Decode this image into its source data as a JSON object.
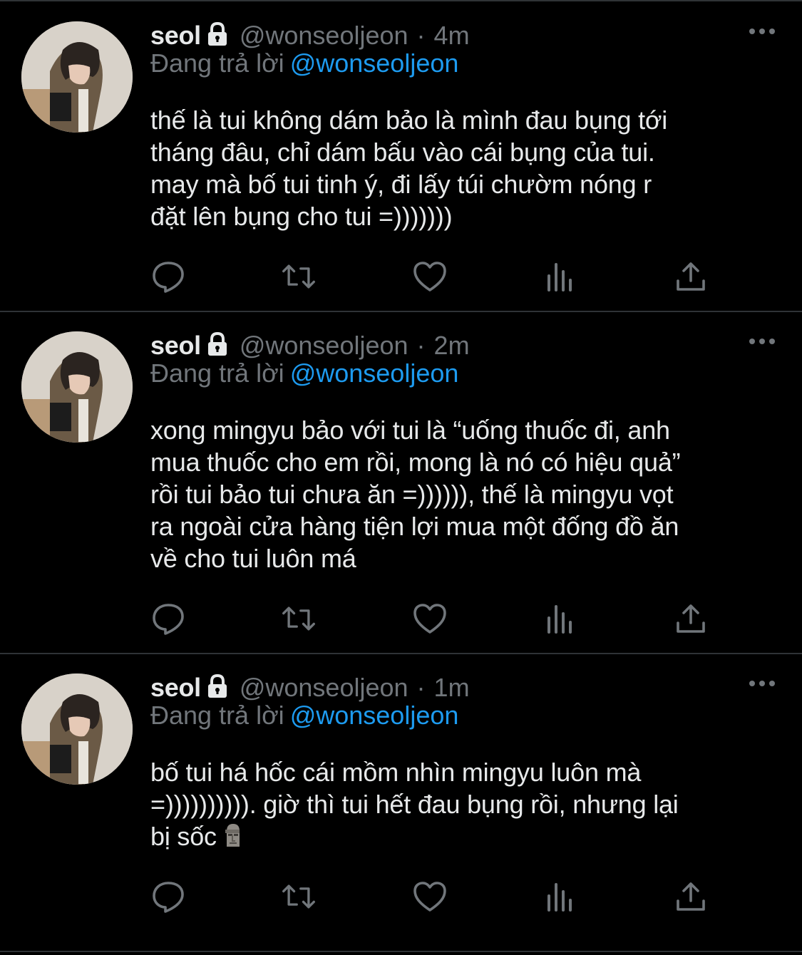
{
  "colors": {
    "background": "#000000",
    "text_primary": "#e7e9ea",
    "text_secondary": "#71767b",
    "accent": "#1d9bf0",
    "divider": "#2f3336"
  },
  "tweets": [
    {
      "name": "seol",
      "locked_icon": "lock-icon",
      "handle": "@wonseoljeon",
      "separator": "·",
      "time": "4m",
      "reply_prefix": "Đang trả lời",
      "reply_to": "@wonseoljeon",
      "text": "thế là tui không dám bảo là mình đau bụng tới\ntháng đâu, chỉ dám bấu vào cái bụng của tui.\nmay mà bố tui tinh ý, đi lấy túi chườm nóng r\nđặt lên bụng cho tui =)))))))",
      "emoji": ""
    },
    {
      "name": "seol",
      "locked_icon": "lock-icon",
      "handle": "@wonseoljeon",
      "separator": "·",
      "time": "2m",
      "reply_prefix": "Đang trả lời",
      "reply_to": "@wonseoljeon",
      "text": "xong mingyu bảo với tui là “uống thuốc đi, anh\nmua thuốc cho em rồi, mong là nó có hiệu quả”\nrồi tui bảo tui chưa ăn =)))))), thế là mingyu vọt\nra ngoài cửa hàng tiện lợi mua một đống đồ ăn\nvề cho tui luôn má",
      "emoji": ""
    },
    {
      "name": "seol",
      "locked_icon": "lock-icon",
      "handle": "@wonseoljeon",
      "separator": "·",
      "time": "1m",
      "reply_prefix": "Đang trả lời",
      "reply_to": "@wonseoljeon",
      "text": "bố tui há hốc cái mồm nhìn mingyu luôn mà\n=)))))))))). giờ thì tui hết đau bụng rồi, nhưng lại\nbị sốc",
      "emoji": "moai"
    }
  ],
  "action_icons": [
    "reply-icon",
    "retweet-icon",
    "like-icon",
    "analytics-icon",
    "share-icon"
  ]
}
